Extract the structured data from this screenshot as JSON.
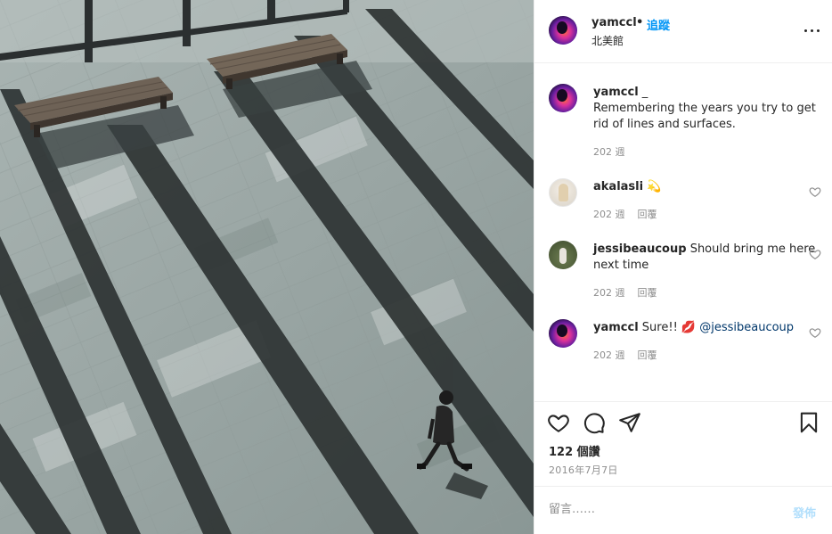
{
  "header": {
    "username": "yamccl",
    "separator": "•",
    "follow_label": "追蹤",
    "location": "北美館",
    "more_icon": "more-horizontal-icon"
  },
  "caption": {
    "username": "yamccl",
    "suffix": " _",
    "text": "Remembering the years you try to get rid of lines and surfaces.",
    "time": "202 週"
  },
  "comments": [
    {
      "username": "akalasli",
      "text": " 💫",
      "time": "202 週",
      "reply_label": "回覆"
    },
    {
      "username": "jessibeaucoup",
      "text": " Should bring me here next time",
      "time": "202 週",
      "reply_label": "回覆"
    },
    {
      "username": "yamccl",
      "text": " Sure!! 💋 ",
      "mention": "@jessibeaucoup",
      "time": "202 週",
      "reply_label": "回覆"
    }
  ],
  "actions": {
    "like_icon": "heart-icon",
    "comment_icon": "comment-icon",
    "share_icon": "paper-plane-icon",
    "save_icon": "bookmark-icon",
    "likes": "122 個讚",
    "date": "2016年7月7日"
  },
  "add_comment": {
    "placeholder": "留言……",
    "post_label": "發佈"
  },
  "colors": {
    "accent": "#0095f6",
    "post_disabled": "#b2dffc",
    "mention": "#00376b",
    "muted": "#8e8e8e"
  }
}
